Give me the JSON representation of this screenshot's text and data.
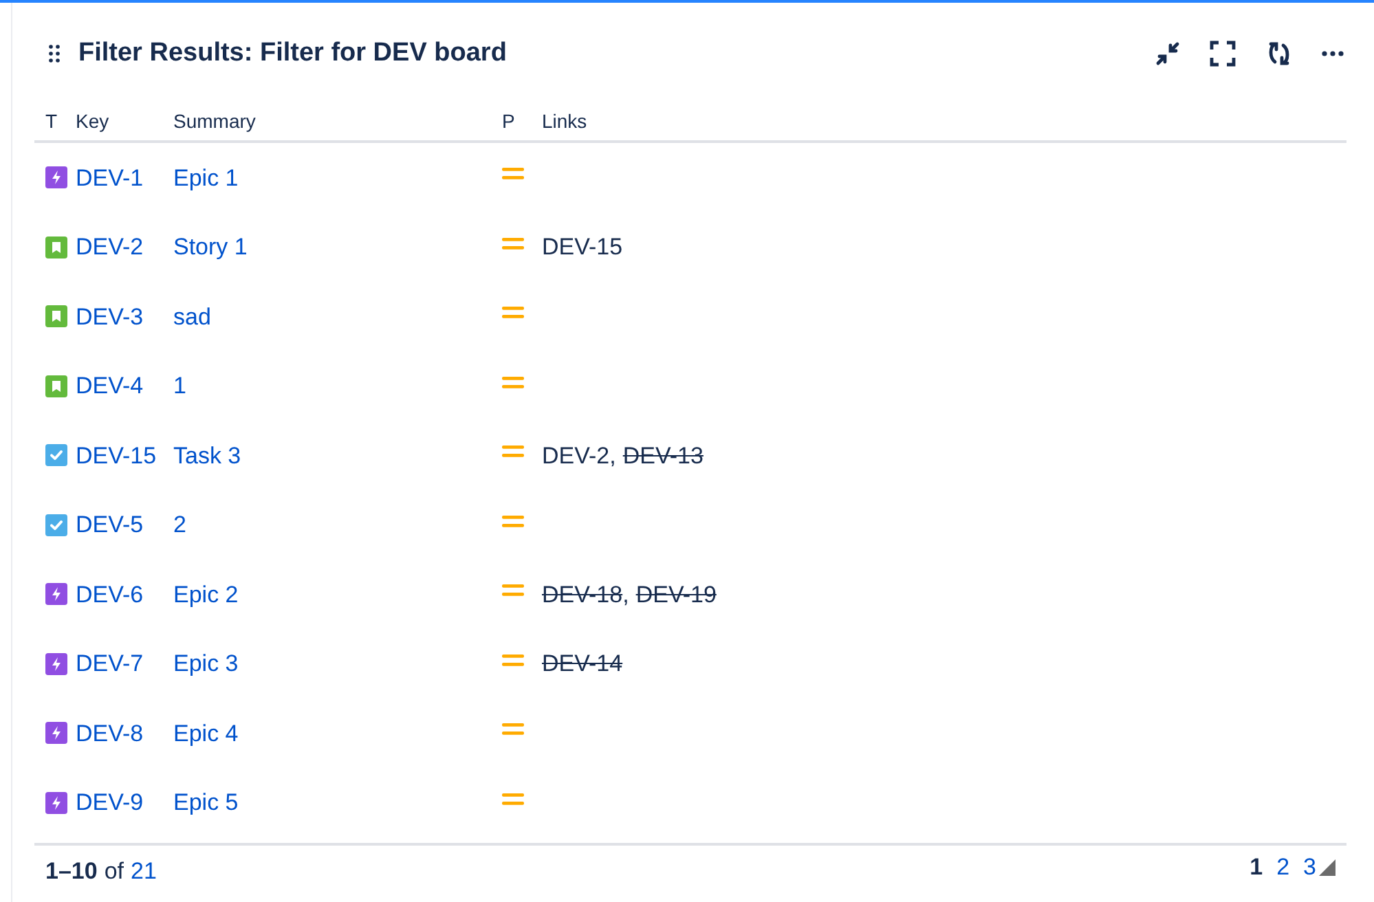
{
  "title": "Filter Results: Filter for DEV board",
  "columns": [
    "T",
    "Key",
    "Summary",
    "P",
    "Links"
  ],
  "rows": [
    {
      "kind": "epic",
      "key": "DEV-1",
      "summary": "Epic 1",
      "links": []
    },
    {
      "kind": "story",
      "key": "DEV-2",
      "summary": "Story 1",
      "links": [
        {
          "text": "DEV-15",
          "resolved": false
        }
      ]
    },
    {
      "kind": "story",
      "key": "DEV-3",
      "summary": "sad",
      "links": []
    },
    {
      "kind": "story",
      "key": "DEV-4",
      "summary": "1",
      "links": []
    },
    {
      "kind": "task",
      "key": "DEV-15",
      "summary": "Task 3",
      "links": [
        {
          "text": "DEV-2",
          "resolved": false
        },
        {
          "text": "DEV-13",
          "resolved": true
        }
      ]
    },
    {
      "kind": "task",
      "key": "DEV-5",
      "summary": "2",
      "links": []
    },
    {
      "kind": "epic",
      "key": "DEV-6",
      "summary": "Epic 2",
      "links": [
        {
          "text": "DEV-18",
          "resolved": true
        },
        {
          "text": "DEV-19",
          "resolved": true
        }
      ]
    },
    {
      "kind": "epic",
      "key": "DEV-7",
      "summary": "Epic 3",
      "links": [
        {
          "text": "DEV-14",
          "resolved": true
        }
      ]
    },
    {
      "kind": "epic",
      "key": "DEV-8",
      "summary": "Epic 4",
      "links": []
    },
    {
      "kind": "epic",
      "key": "DEV-9",
      "summary": "Epic 5",
      "links": []
    }
  ],
  "link_separator": ",",
  "footer": {
    "range": "1–10",
    "of": "of",
    "total": "21"
  },
  "pages": [
    {
      "label": "1",
      "selected": true
    },
    {
      "label": "2",
      "selected": false
    },
    {
      "label": "3",
      "selected": false
    }
  ]
}
